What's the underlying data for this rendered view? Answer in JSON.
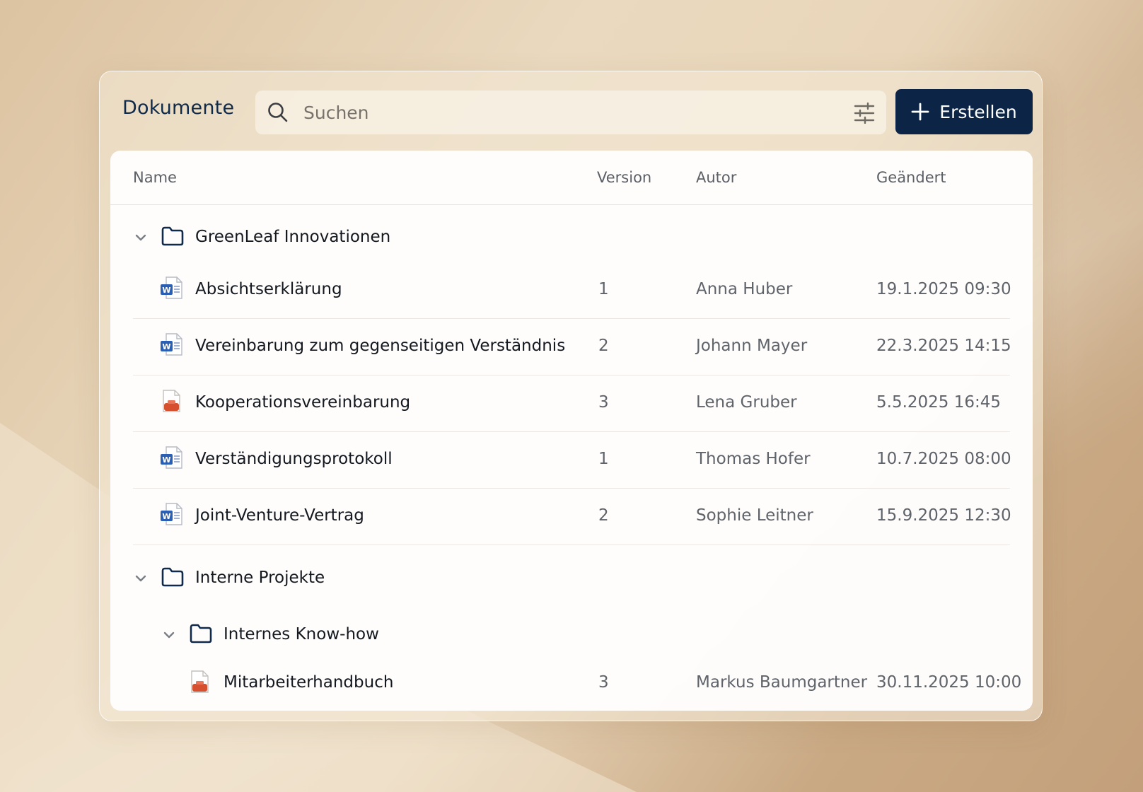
{
  "header": {
    "title": "Dokumente",
    "search_placeholder": "Suchen",
    "create_label": "Erstellen"
  },
  "table": {
    "columns": [
      "Name",
      "Version",
      "Autor",
      "Geändert"
    ],
    "folders": [
      {
        "name": "GreenLeaf Innovationen",
        "files": [
          {
            "name": "Absichtserklärung",
            "type": "word-icon",
            "version": "1",
            "author": "Anna Huber",
            "modified": "19.1.2025 09:30"
          },
          {
            "name": "Vereinbarung zum gegenseitigen Verständnis",
            "type": "word-icon",
            "version": "2",
            "author": "Johann Mayer",
            "modified": "22.3.2025 14:15"
          },
          {
            "name": "Kooperationsvereinbarung",
            "type": "pdf-icon",
            "version": "3",
            "author": "Lena Gruber",
            "modified": "5.5.2025 16:45"
          },
          {
            "name": "Verständigungsprotokoll",
            "type": "word-icon",
            "version": "1",
            "author": "Thomas Hofer",
            "modified": "10.7.2025 08:00"
          },
          {
            "name": "Joint-Venture-Vertrag",
            "type": "word-icon",
            "version": "2",
            "author": "Sophie Leitner",
            "modified": "15.9.2025 12:30"
          }
        ]
      },
      {
        "name": "Interne Projekte",
        "subfolders": [
          {
            "name": "Internes Know-how",
            "files": [
              {
                "name": "Mitarbeiterhandbuch",
                "type": "pdf-icon",
                "version": "3",
                "author": "Markus Baumgartner",
                "modified": "30.11.2025 10:00"
              }
            ]
          }
        ]
      }
    ]
  },
  "colors": {
    "accent": "#0c2547",
    "folder_stroke": "#0f2a4a",
    "word_blue": "#2b5fb4",
    "pdf_red": "#d6502f"
  }
}
